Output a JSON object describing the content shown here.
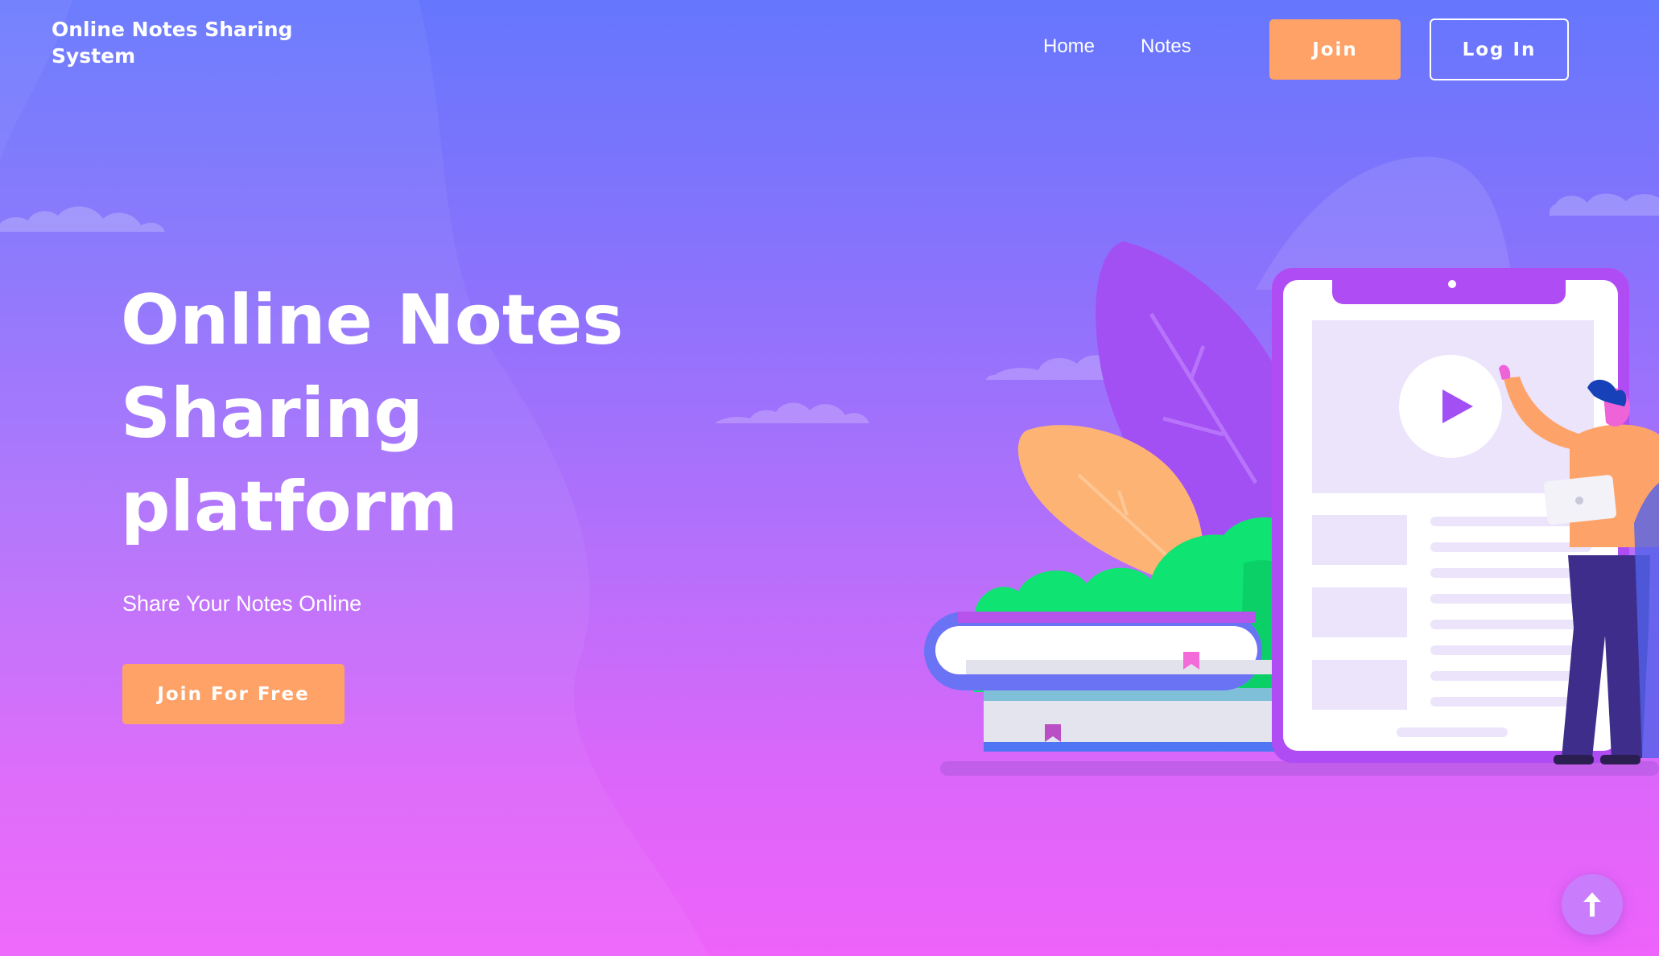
{
  "header": {
    "brand": "Online Notes Sharing System",
    "nav": {
      "home": "Home",
      "notes": "Notes"
    },
    "join_label": "Join",
    "login_label": "Log In"
  },
  "hero": {
    "title": "Online Notes Sharing platform",
    "subtitle": "Share Your Notes Online",
    "cta_label": "Join For Free"
  },
  "icons": {
    "scroll_top": "arrow-up-icon",
    "video": "play-icon"
  },
  "colors": {
    "accent": "#fea267",
    "gradient_top": "#6577fd",
    "gradient_bottom": "#ee63fa"
  }
}
